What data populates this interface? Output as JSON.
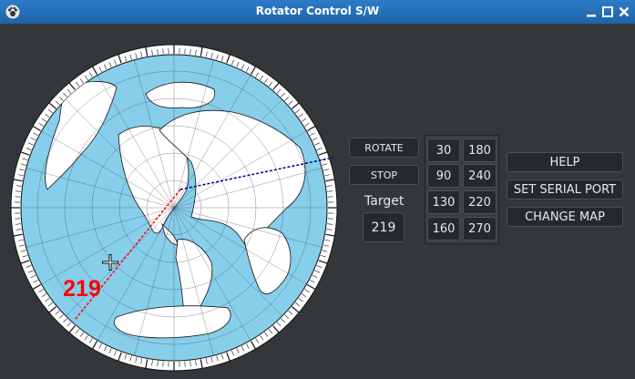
{
  "window": {
    "title": "Rotator Control S/W"
  },
  "map": {
    "bearing": 219,
    "bearing_label": "219",
    "target_color": "#ff0000",
    "long_path_color": "#00008b"
  },
  "controls": {
    "rotate_label": "ROTATE",
    "stop_label": "STOP",
    "target_label": "Target",
    "target_value": "219"
  },
  "presets": [
    "30",
    "180",
    "90",
    "240",
    "130",
    "220",
    "160",
    "270"
  ],
  "actions": {
    "help_label": "HELP",
    "serial_label": "SET SERIAL PORT",
    "map_label": "CHANGE MAP"
  },
  "icons": {
    "app": "pawprint-icon",
    "minimize": "minimize-icon",
    "maximize": "maximize-icon",
    "close": "close-icon"
  }
}
